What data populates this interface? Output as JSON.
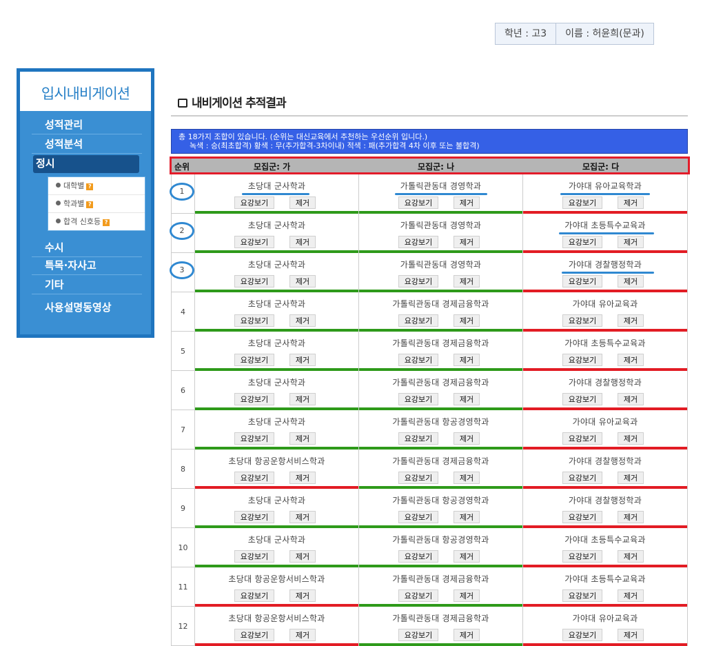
{
  "user": {
    "grade_label": "학년 : 고3",
    "name_label": "이름 : 허윤희(문과)"
  },
  "sidebar": {
    "title": "입시내비게이션",
    "items": [
      "성적관리",
      "성적분석",
      "정시",
      "수시",
      "특목·자사고",
      "기타",
      "사용설명동영상"
    ],
    "active": "정시",
    "sub_items": [
      "대학별",
      "학과별",
      "합격 신호등"
    ]
  },
  "section_title": "내비게이션 추적결과",
  "info": {
    "line1": "총 18가지 조합이 있습니다. (순위는 대신교육에서 추천하는 우선순위 입니다.)",
    "line2": "녹색 : 승(최초합격)    황색 : 무(추가합격-3차이내)    적색 : 패(추가합격 4차 이후 또는 불합격)"
  },
  "table": {
    "headers": [
      "순위",
      "모집군: 가",
      "모집군: 나",
      "모집군: 다"
    ],
    "view_label": "요강보기",
    "remove_label": "제거",
    "colors": {
      "green": "#2e9a1a",
      "red": "#e21c24",
      "highlight": "#2f88d1"
    },
    "rows": [
      {
        "rank": "1",
        "cells": [
          [
            "초당대 군사학과",
            "green"
          ],
          [
            "가톨릭관동대 경영학과",
            "green"
          ],
          [
            "가야대 유아교육학과",
            "red"
          ]
        ]
      },
      {
        "rank": "2",
        "cells": [
          [
            "초당대 군사학과",
            "green"
          ],
          [
            "가톨릭관동대 경영학과",
            "green"
          ],
          [
            "가야대 초등특수교육과",
            "red"
          ]
        ]
      },
      {
        "rank": "3",
        "cells": [
          [
            "초당대 군사학과",
            "green"
          ],
          [
            "가톨릭관동대 경영학과",
            "green"
          ],
          [
            "가야대 경찰행정학과",
            "red"
          ]
        ]
      },
      {
        "rank": "4",
        "cells": [
          [
            "초당대 군사학과",
            "green"
          ],
          [
            "가톨릭관동대 경제금융학과",
            "green"
          ],
          [
            "가야대 유아교육과",
            "red"
          ]
        ]
      },
      {
        "rank": "5",
        "cells": [
          [
            "초당대 군사학과",
            "green"
          ],
          [
            "가톨릭관동대 경제금융학과",
            "green"
          ],
          [
            "가야대 초등특수교육과",
            "red"
          ]
        ]
      },
      {
        "rank": "6",
        "cells": [
          [
            "초당대 군사학과",
            "green"
          ],
          [
            "가톨릭관동대 경제금융학과",
            "green"
          ],
          [
            "가야대 경찰행정학과",
            "red"
          ]
        ]
      },
      {
        "rank": "7",
        "cells": [
          [
            "초당대 군사학과",
            "green"
          ],
          [
            "가톨릭관동대 항공경영학과",
            "green"
          ],
          [
            "가야대 유아교육과",
            "red"
          ]
        ]
      },
      {
        "rank": "8",
        "cells": [
          [
            "초당대 항공운항서비스학과",
            "red"
          ],
          [
            "가톨릭관동대 경제금융학과",
            "green"
          ],
          [
            "가야대 경찰행정학과",
            "red"
          ]
        ]
      },
      {
        "rank": "9",
        "cells": [
          [
            "초당대 군사학과",
            "green"
          ],
          [
            "가톨릭관동대 항공경영학과",
            "green"
          ],
          [
            "가야대 경찰행정학과",
            "red"
          ]
        ]
      },
      {
        "rank": "10",
        "cells": [
          [
            "초당대 군사학과",
            "green"
          ],
          [
            "가톨릭관동대 항공경영학과",
            "green"
          ],
          [
            "가야대 초등특수교육과",
            "red"
          ]
        ]
      },
      {
        "rank": "11",
        "cells": [
          [
            "초당대 항공운항서비스학과",
            "red"
          ],
          [
            "가톨릭관동대 경제금융학과",
            "green"
          ],
          [
            "가야대 초등특수교육과",
            "red"
          ]
        ]
      },
      {
        "rank": "12",
        "cells": [
          [
            "초당대 항공운항서비스학과",
            "red"
          ],
          [
            "가톨릭관동대 경제금융학과",
            "green"
          ],
          [
            "가야대 유아교육과",
            "red"
          ]
        ]
      }
    ]
  }
}
